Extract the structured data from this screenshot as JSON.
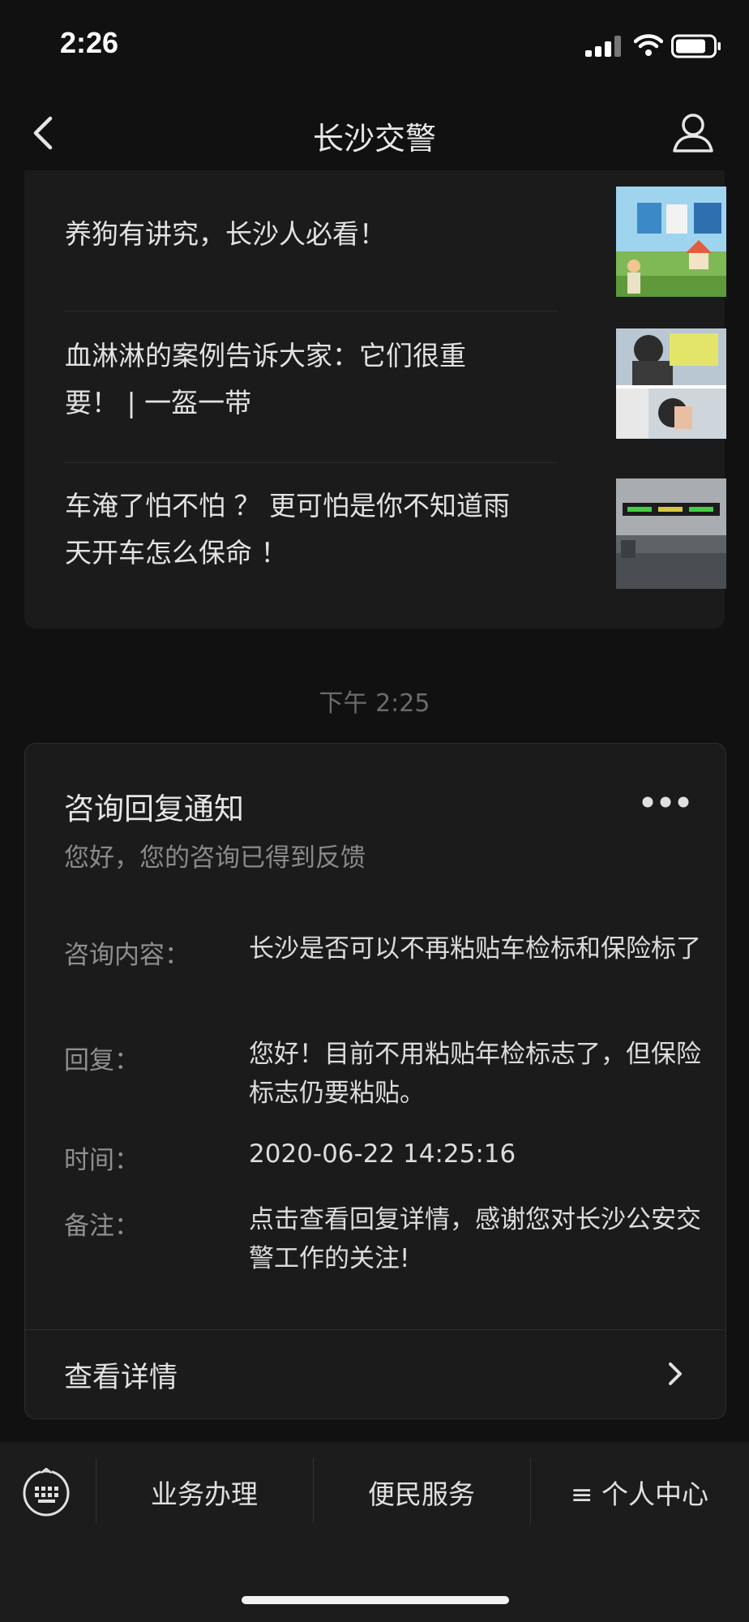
{
  "status_bar": {
    "time": "2:26"
  },
  "nav": {
    "title": "长沙交警"
  },
  "articles": [
    {
      "title": "养狗有讲究，长沙人必看！"
    },
    {
      "title": "血淋淋的案例告诉大家：它们很重要！ | 一盔一带"
    },
    {
      "title": "车淹了怕不怕 ？ 更可怕是你不知道雨天开车怎么保命 ！"
    }
  ],
  "timestamp": "下午 2:25",
  "notice": {
    "title": "咨询回复通知",
    "subtitle": "您好，您的咨询已得到反馈",
    "rows": [
      {
        "label": "咨询内容：",
        "value": "长沙是否可以不再粘贴车检标和保险标了"
      },
      {
        "label": "回复：",
        "value": "您好！目前不用粘贴年检标志了，但保险标志仍要粘贴。"
      },
      {
        "label": "时间：",
        "value": "2020-06-22 14:25:16"
      },
      {
        "label": "备注：",
        "value": "点击查看回复详情，感谢您对长沙公安交警工作的关注!"
      }
    ],
    "detail_label": "查看详情"
  },
  "bottom_menu": {
    "items": [
      {
        "label": "业务办理"
      },
      {
        "label": "便民服务"
      },
      {
        "label": "≡ 个人中心"
      }
    ]
  },
  "icons": {
    "back": "back-chevron-icon",
    "profile": "user-profile-icon",
    "more": "more-dots-icon",
    "keyboard": "keyboard-icon",
    "signal": "cellular-signal-icon",
    "wifi": "wifi-icon",
    "battery": "battery-icon"
  },
  "colors": {
    "background": "#111111",
    "card": "#1b1b1b",
    "text": "#e2e2e2",
    "muted": "#8a8a8a"
  }
}
